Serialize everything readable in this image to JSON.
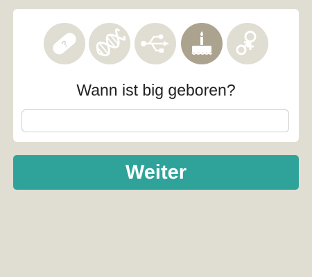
{
  "steps": [
    {
      "icon": "bandage-icon",
      "state": "inactive"
    },
    {
      "icon": "dna-icon",
      "state": "inactive"
    },
    {
      "icon": "usb-icon",
      "state": "inactive"
    },
    {
      "icon": "birthday-cake-icon",
      "state": "active"
    },
    {
      "icon": "gender-icon",
      "state": "inactive"
    }
  ],
  "question": {
    "text": "Wann ist big geboren?"
  },
  "date_field": {
    "value": "",
    "placeholder": ""
  },
  "continue_button": {
    "label": "Weiter"
  },
  "colors": {
    "background": "#e0ddd2",
    "card": "#ffffff",
    "step_inactive": "#e0ddd2",
    "step_active": "#aca38f",
    "button": "#2fa39a",
    "button_text": "#ffffff"
  }
}
